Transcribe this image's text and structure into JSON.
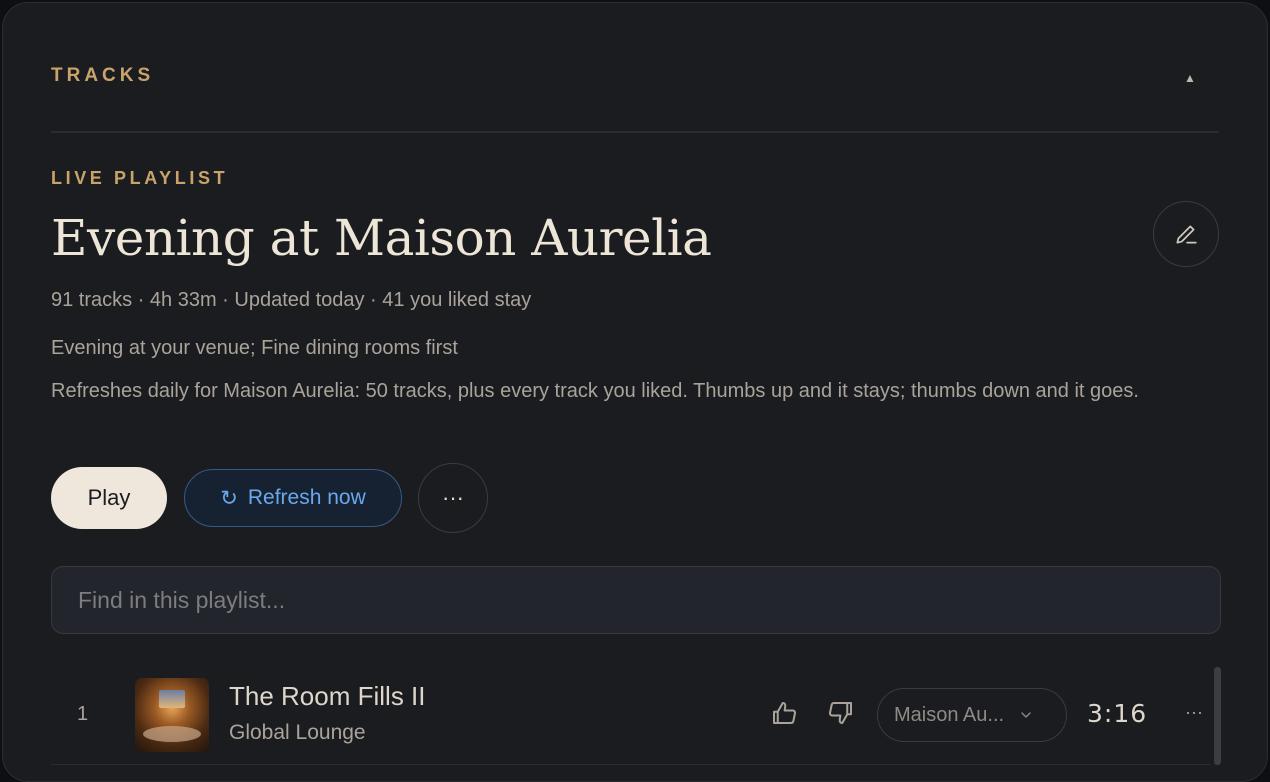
{
  "section": {
    "title": "TRACKS",
    "collapse_icon": "▲"
  },
  "playlist": {
    "eyebrow": "LIVE PLAYLIST",
    "title": "Evening at Maison Aurelia",
    "meta": "91 tracks · 4h 33m · Updated today · 41 you liked stay",
    "description_short": "Evening at your venue; Fine dining rooms first",
    "description_long": "Refreshes daily for Maison Aurelia: 50 tracks, plus every track you liked. Thumbs up and it stays; thumbs down and it goes."
  },
  "actions": {
    "play_label": "Play",
    "refresh_icon": "↻",
    "refresh_label": "Refresh now",
    "more_label": "···"
  },
  "search": {
    "placeholder": "Find in this playlist..."
  },
  "tracks": [
    {
      "number": "1",
      "title": "The Room Fills II",
      "artist": "Global Lounge",
      "venue": "Maison Au...",
      "duration": "3:16",
      "more_label": "···"
    }
  ],
  "colors": {
    "accent": "#c9a46a",
    "panel": "#1b1c20",
    "refresh": "#6aa8ec"
  }
}
